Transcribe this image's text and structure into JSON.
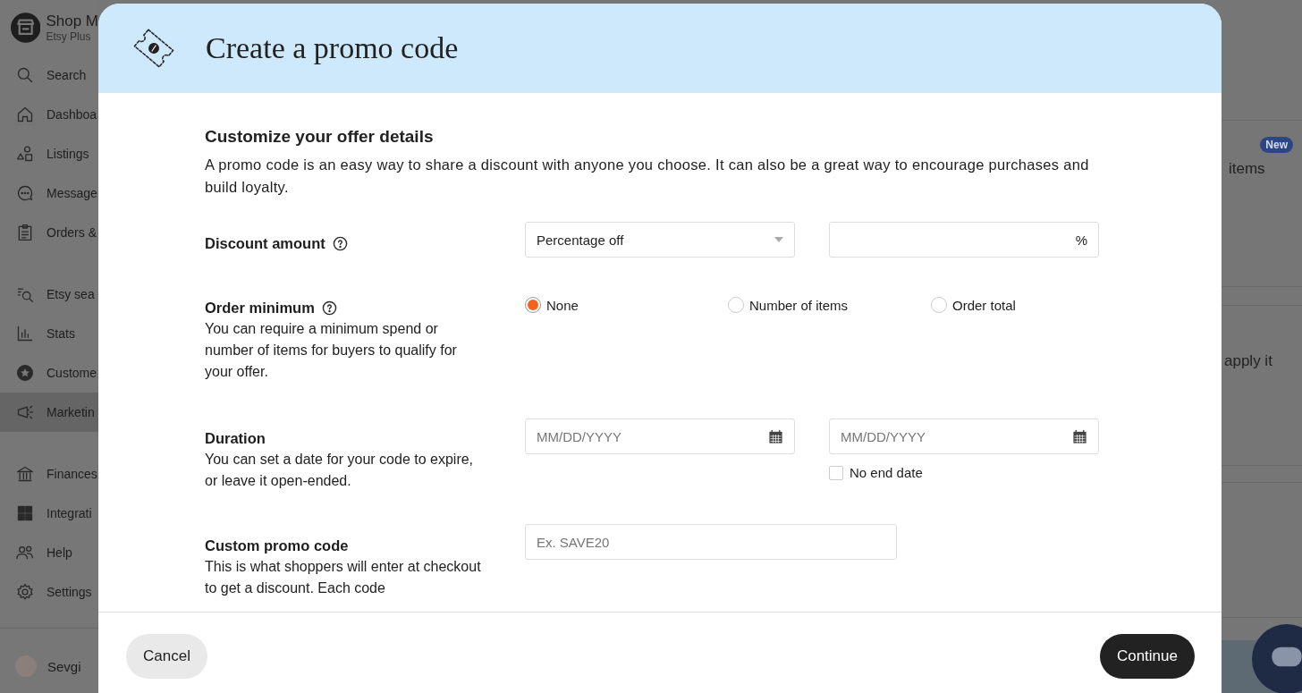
{
  "sidebar": {
    "shop_name": "Shop M",
    "plan": "Etsy Plus",
    "groups": [
      [
        {
          "kind": "search",
          "label": "Search",
          "selected": false
        },
        {
          "kind": "home",
          "label": "Dashboa",
          "selected": false
        },
        {
          "kind": "shapes",
          "label": "Listings",
          "selected": false
        },
        {
          "kind": "chat",
          "label": "Message",
          "selected": false
        },
        {
          "kind": "clipboard",
          "label": "Orders &",
          "selected": false
        }
      ],
      [
        {
          "kind": "seo",
          "label": "Etsy sea",
          "selected": false
        },
        {
          "kind": "stats",
          "label": "Stats",
          "selected": false
        },
        {
          "kind": "star",
          "label": "Custome",
          "selected": false
        },
        {
          "kind": "megaphone",
          "label": "Marketin",
          "selected": true
        }
      ],
      [
        {
          "kind": "bank",
          "label": "Finances",
          "selected": false
        },
        {
          "kind": "grid",
          "label": "Integrati",
          "selected": false
        },
        {
          "kind": "people",
          "label": "Help",
          "selected": false
        },
        {
          "kind": "gear",
          "label": "Settings",
          "selected": false
        }
      ]
    ],
    "user": "Sevgi"
  },
  "background": {
    "badge": "New",
    "texts": [
      "items",
      "apply it"
    ]
  },
  "modal": {
    "title": "Create a promo code",
    "heading": "Customize your offer details",
    "intro": "A promo code is an easy way to share a discount with anyone you choose. It can also be a great way to encourage purchases and build loyalty.",
    "rows": [
      {
        "kind": "discount",
        "label": "Discount amount",
        "help": true,
        "select": "Percentage off",
        "suffix": "%"
      },
      {
        "kind": "radios",
        "label": "Order minimum",
        "help": true,
        "description": "You can require a minimum spend or number of items for buyers to qualify for your offer.",
        "options": [
          {
            "label": "None",
            "selected": true
          },
          {
            "label": "Number of items",
            "selected": false
          },
          {
            "label": "Order total",
            "selected": false
          }
        ]
      },
      {
        "kind": "dates",
        "label": "Duration",
        "help": false,
        "description": "You can set a date for your code to expire, or leave it open-ended.",
        "start_placeholder": "MM/DD/YYYY",
        "end_placeholder": "MM/DD/YYYY",
        "no_end_date": {
          "label": "No end date",
          "checked": false
        }
      },
      {
        "kind": "code",
        "label": "Custom promo code",
        "help": false,
        "description": "This is what shoppers will enter at checkout to get a discount. Each code",
        "placeholder": "Ex. SAVE20"
      }
    ],
    "buttons": {
      "cancel": "Cancel",
      "continue": "Continue"
    }
  }
}
